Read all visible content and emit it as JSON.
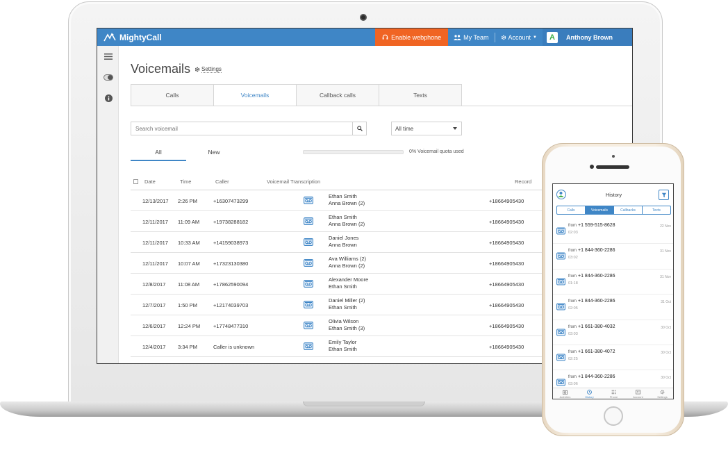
{
  "app": {
    "brand": "MightyCall"
  },
  "header": {
    "webphone_label": "Enable webphone",
    "team_label": "My Team",
    "account_label": "Account",
    "user_initial": "A",
    "user_name": "Anthony Brown"
  },
  "page": {
    "title": "Voicemails",
    "settings_label": "Settings"
  },
  "tabs": [
    {
      "label": "Calls",
      "active": false
    },
    {
      "label": "Voicemails",
      "active": true
    },
    {
      "label": "Callback calls",
      "active": false
    },
    {
      "label": "Texts",
      "active": false
    }
  ],
  "search": {
    "placeholder": "Search voicemail"
  },
  "filter": {
    "selected": "All time"
  },
  "subtabs": {
    "all": "All",
    "new": "New"
  },
  "quota": {
    "percent": 0,
    "label": "0% Voicemail quota used"
  },
  "table": {
    "headers": {
      "date": "Date",
      "time": "Time",
      "caller": "Caller",
      "transcription": "Voicemail Transcription",
      "record": "Record"
    },
    "rows": [
      {
        "date": "12/13/2017",
        "time": "2:26 PM",
        "caller": "+16307473299",
        "from": "Ethan Smith",
        "to": "Anna Brown (2)",
        "record": "+18664905430"
      },
      {
        "date": "12/11/2017",
        "time": "11:09 AM",
        "caller": "+19738288182",
        "from": "Ethan Smith",
        "to": "Anna Brown (2)",
        "record": "+18664905430"
      },
      {
        "date": "12/11/2017",
        "time": "10:33 AM",
        "caller": "+14159038973",
        "from": "Daniel Jones",
        "to": "Anna Brown",
        "record": "+18664905430"
      },
      {
        "date": "12/11/2017",
        "time": "10:07 AM",
        "caller": "+17323130380",
        "from": "Ava Williams (2)",
        "to": "Anna Brown (2)",
        "record": "+18664905430"
      },
      {
        "date": "12/8/2017",
        "time": "11:08 AM",
        "caller": "+17862590094",
        "from": "Alexander Moore",
        "to": "Ethan Smith",
        "record": "+18664905430"
      },
      {
        "date": "12/7/2017",
        "time": "1:50 PM",
        "caller": "+12174039703",
        "from": "Daniel Miller (2)",
        "to": "Ethan Smith",
        "record": "+18664905430"
      },
      {
        "date": "12/6/2017",
        "time": "12:24 PM",
        "caller": "+17748477310",
        "from": "Olivia Wilson",
        "to": "Ethan Smith (3)",
        "record": "+18664905430"
      },
      {
        "date": "12/4/2017",
        "time": "3:34 PM",
        "caller": "Caller is unknown",
        "from": "Emily Taylor",
        "to": "Ethan Smith",
        "record": "+18664905430"
      }
    ]
  },
  "phone": {
    "title": "History",
    "tabs": [
      {
        "label": "Calls",
        "active": false
      },
      {
        "label": "Voicemails",
        "active": true
      },
      {
        "label": "Callbacks",
        "active": false
      },
      {
        "label": "Texts",
        "active": false
      }
    ],
    "from_label": "from",
    "items": [
      {
        "number": "+1 559-515-8628",
        "duration": "02:03",
        "date": "22 Nov"
      },
      {
        "number": "+1 844-360-2286",
        "duration": "03:02",
        "date": "31 Nov"
      },
      {
        "number": "+1 844-360-2286",
        "duration": "01:18",
        "date": "31 Nov"
      },
      {
        "number": "+1 844-360-2286",
        "duration": "02:05",
        "date": "31 Oct"
      },
      {
        "number": "+1 661-380-4032",
        "duration": "03:03",
        "date": "30 Oct"
      },
      {
        "number": "+1 661-380-4072",
        "duration": "02:25",
        "date": "30 Oct"
      },
      {
        "number": "+1 844-360-2286",
        "duration": "03:06",
        "date": "30 Oct"
      }
    ],
    "nav": [
      {
        "label": "Activities",
        "icon": "activities-icon",
        "active": false
      },
      {
        "label": "History",
        "icon": "history-icon",
        "active": true
      },
      {
        "label": "Phone",
        "icon": "dialpad-icon",
        "active": false
      },
      {
        "label": "Account",
        "icon": "account-icon",
        "active": false
      },
      {
        "label": "Settings",
        "icon": "settings-gear-icon",
        "active": false
      }
    ]
  },
  "colors": {
    "brand_blue": "#3f86c6",
    "webphone_orange": "#f06423",
    "avatar_green": "#3fae49"
  }
}
